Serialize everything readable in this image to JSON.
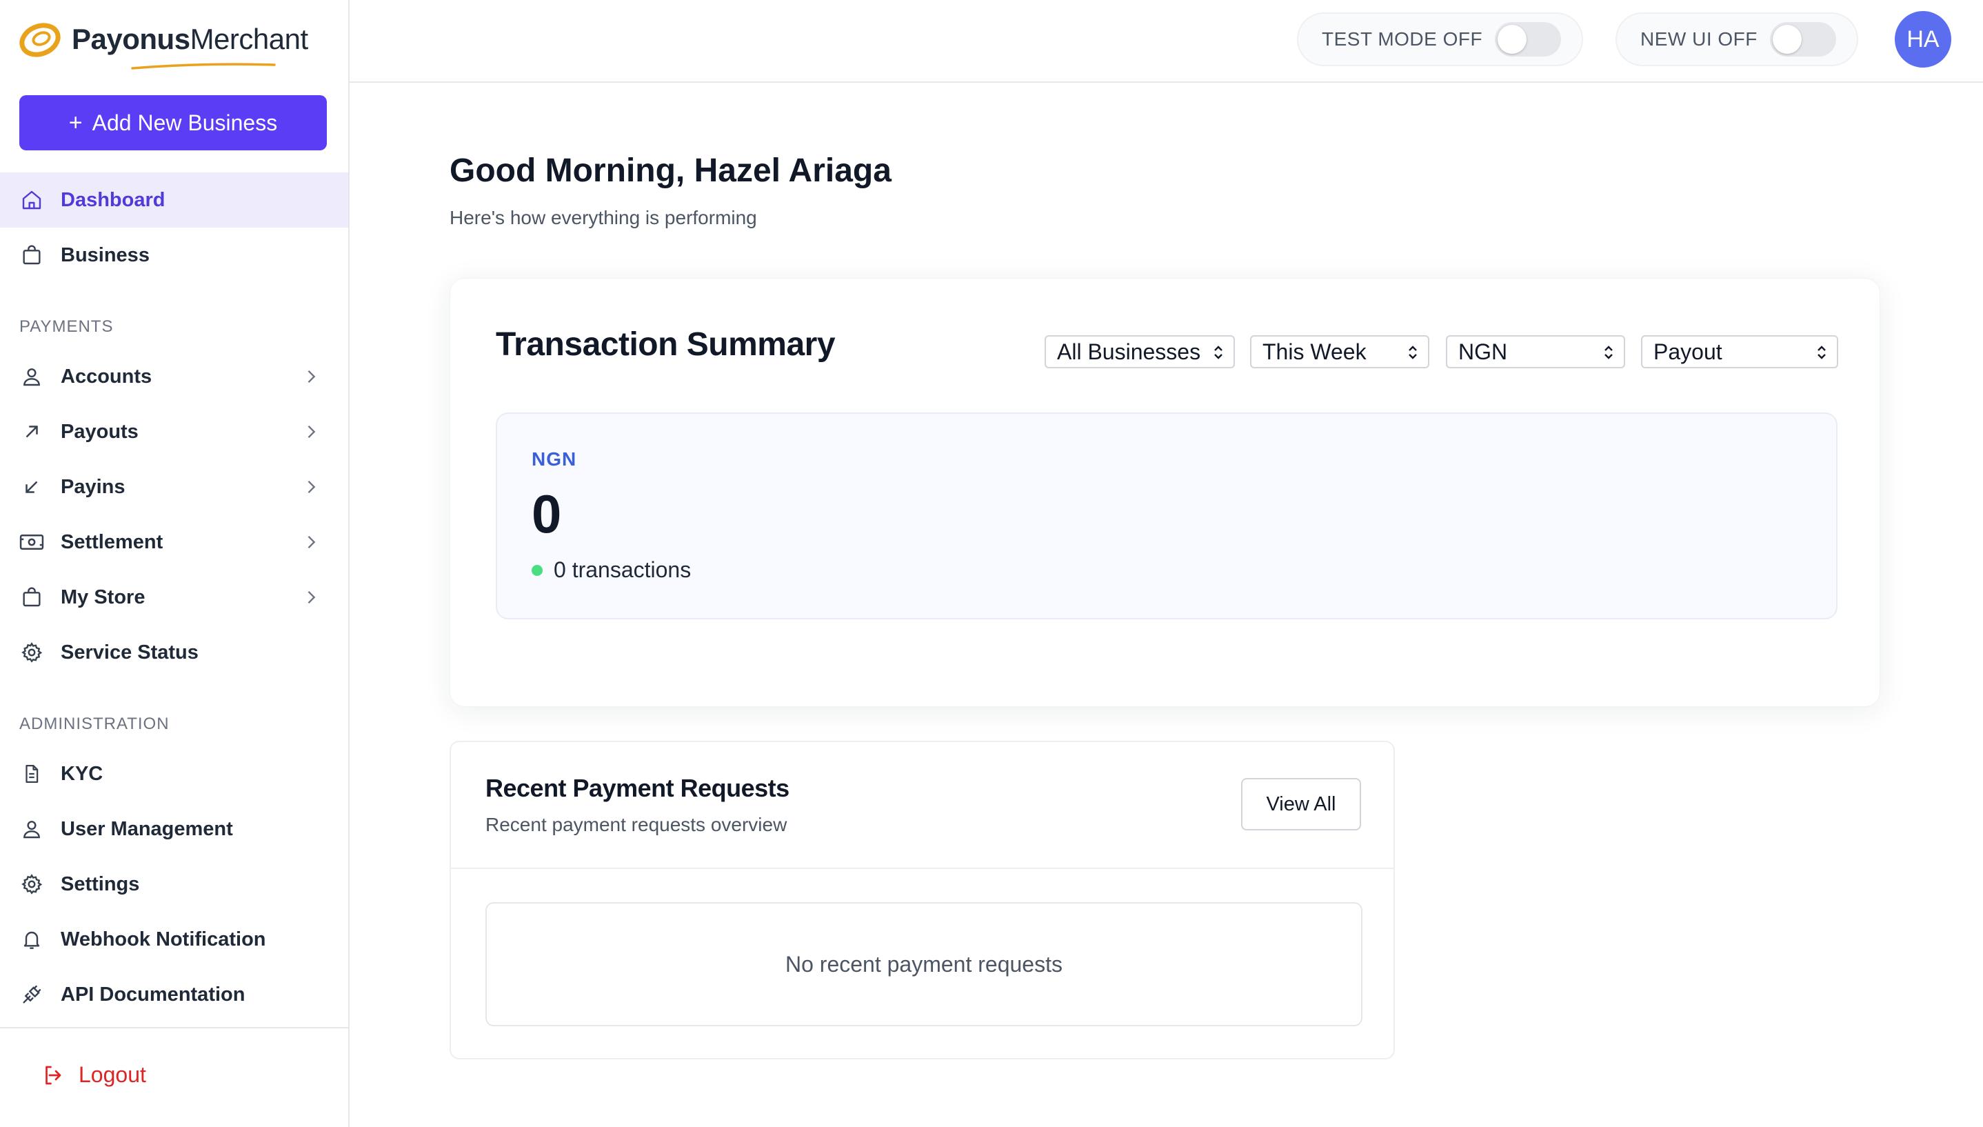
{
  "brand": {
    "name_bold": "Payonus",
    "name_regular": "Merchant",
    "accent": "#e9a21b"
  },
  "sidebar": {
    "add_button": "Add New Business",
    "add_button_icon": "+",
    "items_top": [
      {
        "label": "Dashboard",
        "icon": "home-icon",
        "active": true
      },
      {
        "label": "Business",
        "icon": "bag-icon"
      }
    ],
    "payments_label": "PAYMENTS",
    "payments": [
      {
        "label": "Accounts",
        "icon": "user-icon"
      },
      {
        "label": "Payouts",
        "icon": "arrow-up-right-icon"
      },
      {
        "label": "Payins",
        "icon": "arrow-down-left-icon"
      },
      {
        "label": "Settlement",
        "icon": "cash-icon"
      },
      {
        "label": "My Store",
        "icon": "bag-icon"
      },
      {
        "label": "Service Status",
        "icon": "gear-icon"
      }
    ],
    "admin_label": "ADMINISTRATION",
    "admin": [
      {
        "label": "KYC",
        "icon": "document-icon"
      },
      {
        "label": "User Management",
        "icon": "user-icon"
      },
      {
        "label": "Settings",
        "icon": "gear-icon"
      },
      {
        "label": "Webhook Notification",
        "icon": "bell-icon"
      },
      {
        "label": "API Documentation",
        "icon": "plug-icon"
      }
    ],
    "logout": "Logout"
  },
  "topbar": {
    "test_mode": "TEST MODE OFF",
    "new_ui": "NEW UI OFF",
    "avatar_initials": "HA"
  },
  "main": {
    "greeting": "Good Morning, Hazel Ariaga",
    "subtitle": "Here's how everything is performing",
    "summary": {
      "title": "Transaction Summary",
      "filters": {
        "business": "All Businesses",
        "period": "This Week",
        "currency": "NGN",
        "type": "Payout"
      },
      "currency_label": "NGN",
      "amount": "0",
      "transactions": "0 transactions"
    },
    "recent": {
      "title": "Recent Payment Requests",
      "subtitle": "Recent payment requests overview",
      "view_all": "View All",
      "empty": "No recent payment requests"
    }
  },
  "colors": {
    "primary": "#5b3df5",
    "active_bg": "#eeebfd",
    "active_text": "#4f3bd8",
    "danger": "#dc2626",
    "success": "#4ade80",
    "avatar": "#5b6ef0"
  }
}
